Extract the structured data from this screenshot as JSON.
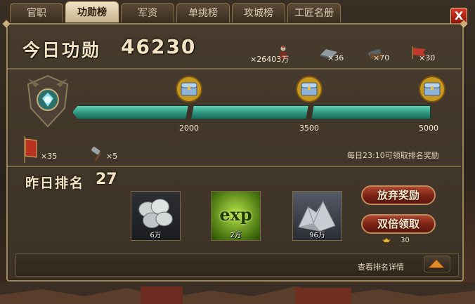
{
  "tabs": [
    {
      "label": "官职",
      "active": false
    },
    {
      "label": "功勋榜",
      "active": true
    },
    {
      "label": "军资",
      "active": false
    },
    {
      "label": "单挑榜",
      "active": false
    },
    {
      "label": "攻城榜",
      "active": false
    },
    {
      "label": "工匠名册",
      "active": false
    }
  ],
  "close_label": "X",
  "today": {
    "label": "今日功勋",
    "value": "46230"
  },
  "resources": [
    {
      "icon": "soldier-icon",
      "text": "×26403万"
    },
    {
      "icon": "siege-cart-icon",
      "text": "×36"
    },
    {
      "icon": "cannon-icon",
      "text": "×70"
    },
    {
      "icon": "war-flag-icon",
      "text": "×30"
    }
  ],
  "progress": {
    "milestones": [
      {
        "value": "2000",
        "icon": "treasure-chest-icon"
      },
      {
        "value": "3500",
        "icon": "treasure-chest-icon"
      },
      {
        "value": "5000",
        "icon": "treasure-chest-icon"
      }
    ],
    "fill": 1.0
  },
  "items": [
    {
      "icon": "banner-icon",
      "text": "×35"
    },
    {
      "icon": "hammer-icon",
      "text": "×5"
    }
  ],
  "daily_hint": "每日23:10可领取排名奖励",
  "yesterday": {
    "label": "昨日排名",
    "value": "27"
  },
  "rewards": [
    {
      "icon": "silver-coins-icon",
      "qty": "6万"
    },
    {
      "icon": "exp-icon",
      "label": "exp",
      "qty": "2万"
    },
    {
      "icon": "ore-icon",
      "qty": "96万"
    }
  ],
  "buttons": {
    "abandon": "放弃奖励",
    "double": "双倍领取"
  },
  "gold_cost": "30",
  "detail_link": "查看排名详情",
  "colors": {
    "accent": "#4fb89f",
    "button": "#7a2214",
    "frame": "#9e8759"
  }
}
